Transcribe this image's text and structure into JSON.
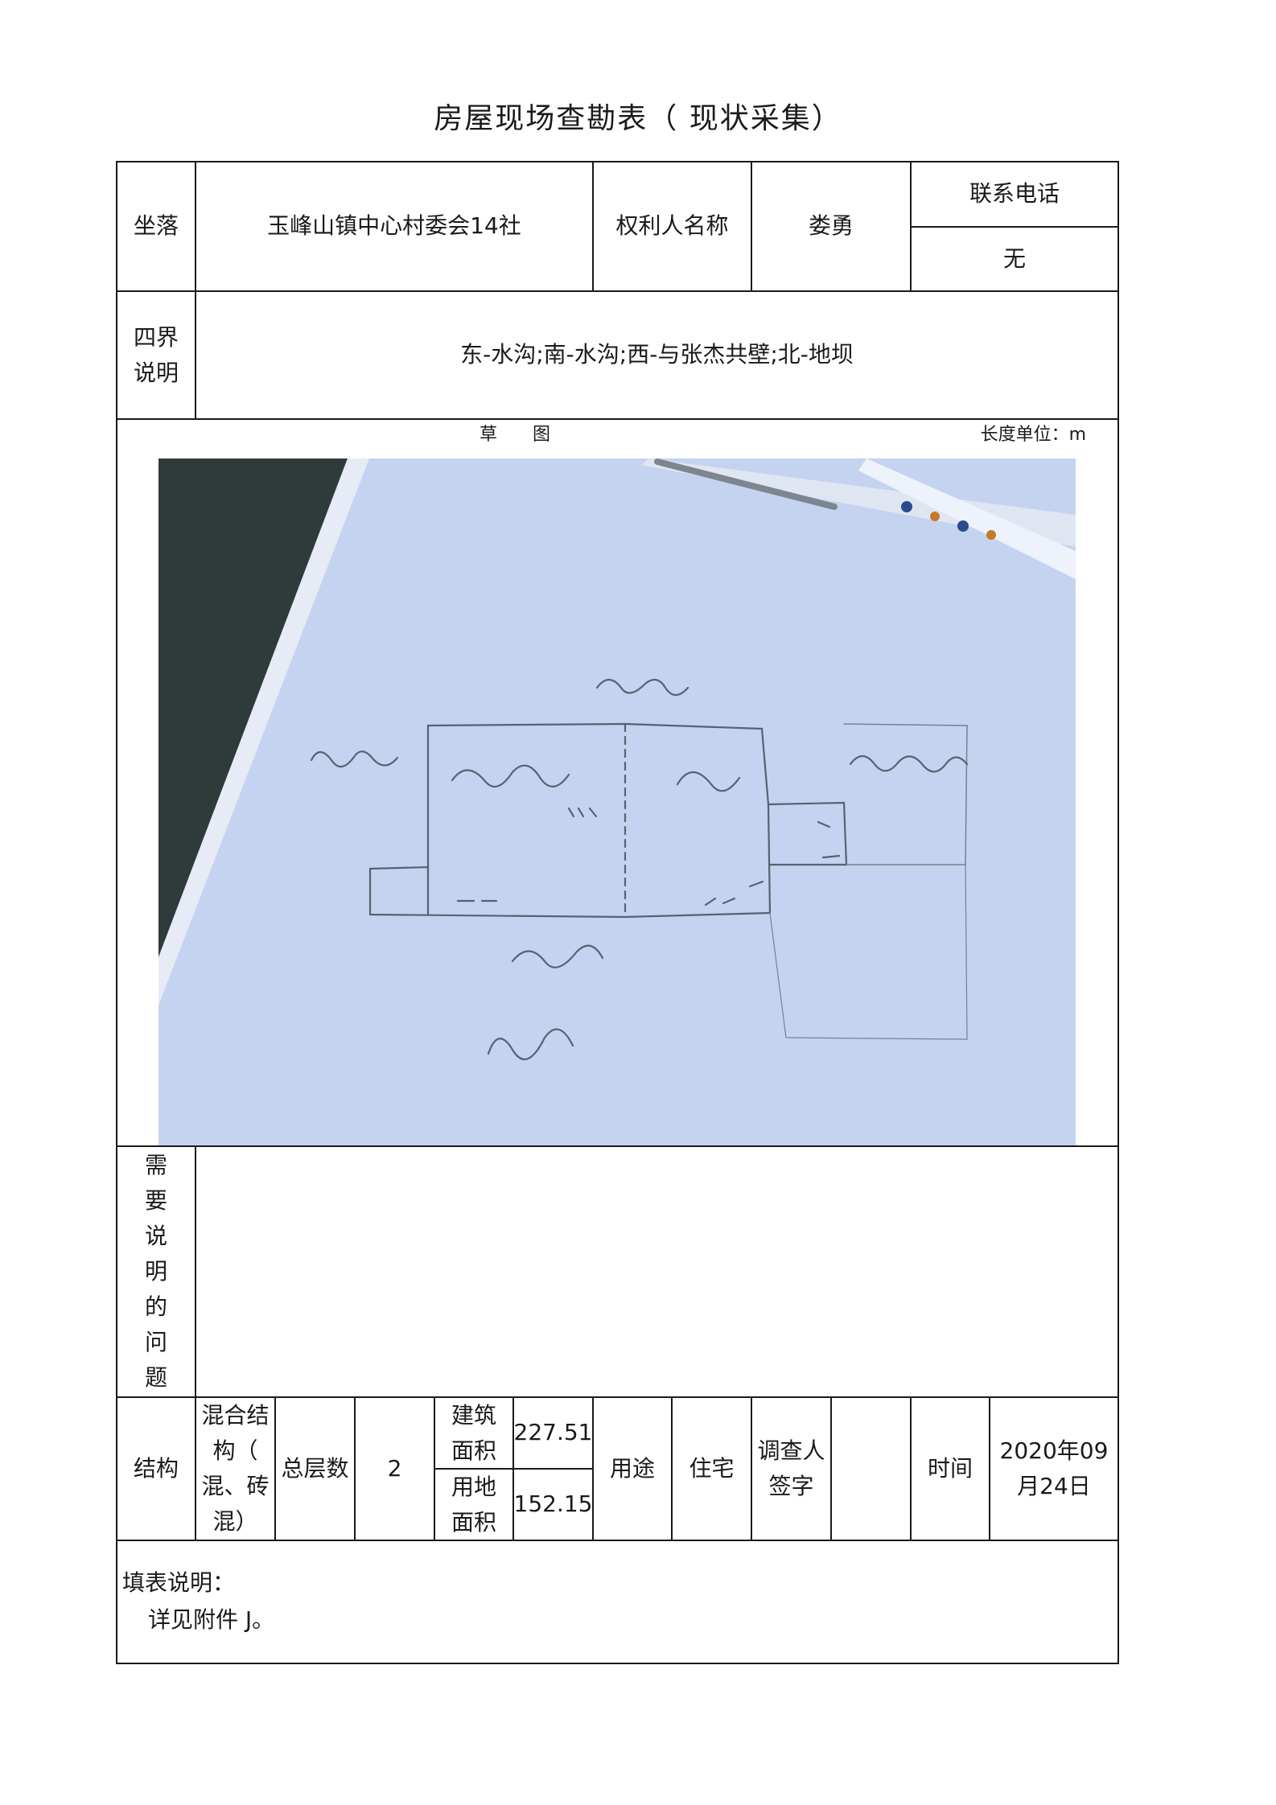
{
  "title": "房屋现场查勘表（ 现状采集）",
  "row1": {
    "location_label": "坐落",
    "location_value": "玉峰山镇中心村委会14社",
    "owner_label": "权利人名称",
    "owner_value": "娄勇",
    "phone_label": "联系电话",
    "phone_value": "无"
  },
  "boundary": {
    "label_line1": "四界",
    "label_line2": "说明",
    "value": "东-水沟;南-水沟;西-与张杰共壁;北-地坝"
  },
  "sketch": {
    "label": "草　　图",
    "unit_label": "长度单位：m"
  },
  "notes": {
    "label_chars": [
      "需",
      "要",
      "说",
      "明",
      "的",
      "问",
      "题"
    ]
  },
  "info": {
    "structure_label": "结构",
    "structure_value_lines": [
      "混合结",
      "构（",
      "混、砖",
      "混）"
    ],
    "floors_label": "总层数",
    "floors_value": "2",
    "building_area_label_lines": [
      "建筑",
      "面积"
    ],
    "building_area_value": "227.51",
    "land_area_label_lines": [
      "用地",
      "面积"
    ],
    "land_area_value": "152.15",
    "usage_label": "用途",
    "usage_value": "住宅",
    "surveyor_label_lines": [
      "调查人",
      "签字"
    ],
    "surveyor_value": "",
    "time_label": "时间",
    "time_value_lines": [
      "2020年09",
      "月24日"
    ]
  },
  "footer": {
    "heading": "填表说明：",
    "detail": "详见附件 J。"
  },
  "colors": {
    "ink": "#1a1a1a",
    "paper_blue": "#c9d6f2",
    "dark_surface": "#2f3b3a",
    "pencil": "#5a6170"
  }
}
